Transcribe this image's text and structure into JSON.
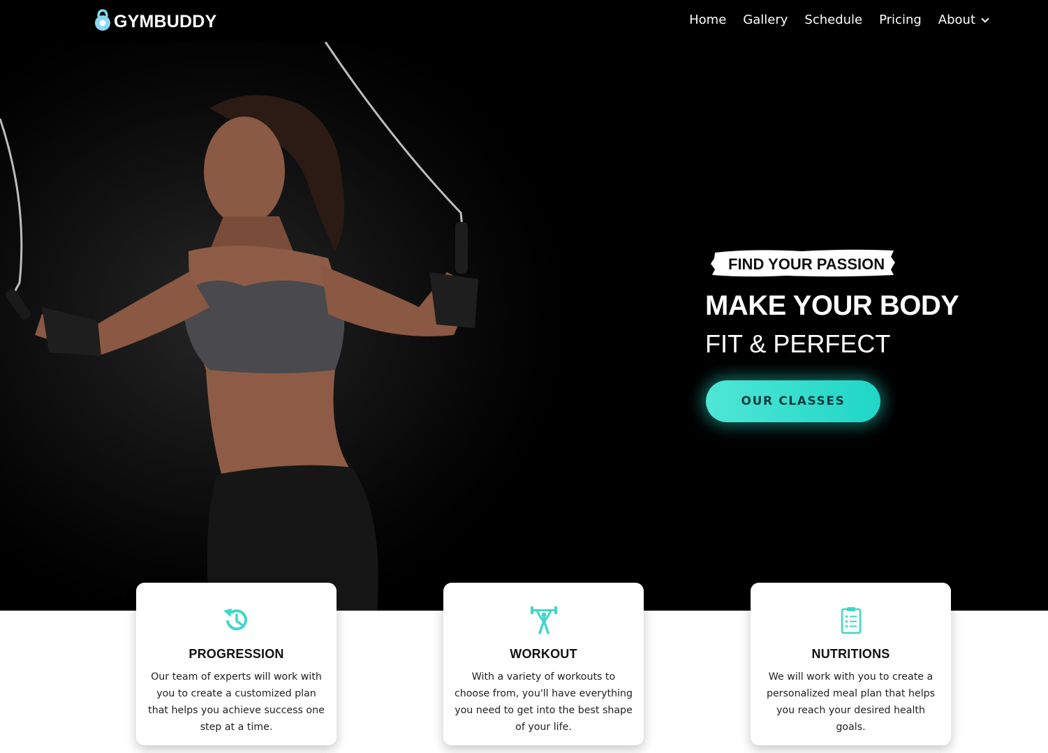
{
  "brand": {
    "name": "GYMBUDDY",
    "accent": "#2fd9c9"
  },
  "nav": {
    "links": [
      {
        "label": "Home"
      },
      {
        "label": "Gallery"
      },
      {
        "label": "Schedule"
      },
      {
        "label": "Pricing"
      },
      {
        "label": "About",
        "icon": "chevron-down-icon"
      }
    ]
  },
  "hero": {
    "tagline": "FIND YOUR PASSION",
    "headline_line1": "MAKE YOUR BODY",
    "headline_line2": "FIT & PERFECT",
    "cta_label": "OUR CLASSES"
  },
  "features": [
    {
      "icon": "history-icon",
      "title": "PROGRESSION",
      "description": "Our team of experts will work with you to create a customized plan that helps you achieve success one step at a time."
    },
    {
      "icon": "weightlifter-icon",
      "title": "WORKOUT",
      "description": "With a variety of workouts to choose from, you'll have everything you need to get into the best shape of your life."
    },
    {
      "icon": "clipboard-list-icon",
      "title": "NUTRITIONS",
      "description": "We will work with you to create a personalized meal plan that helps you reach your desired health goals."
    }
  ]
}
